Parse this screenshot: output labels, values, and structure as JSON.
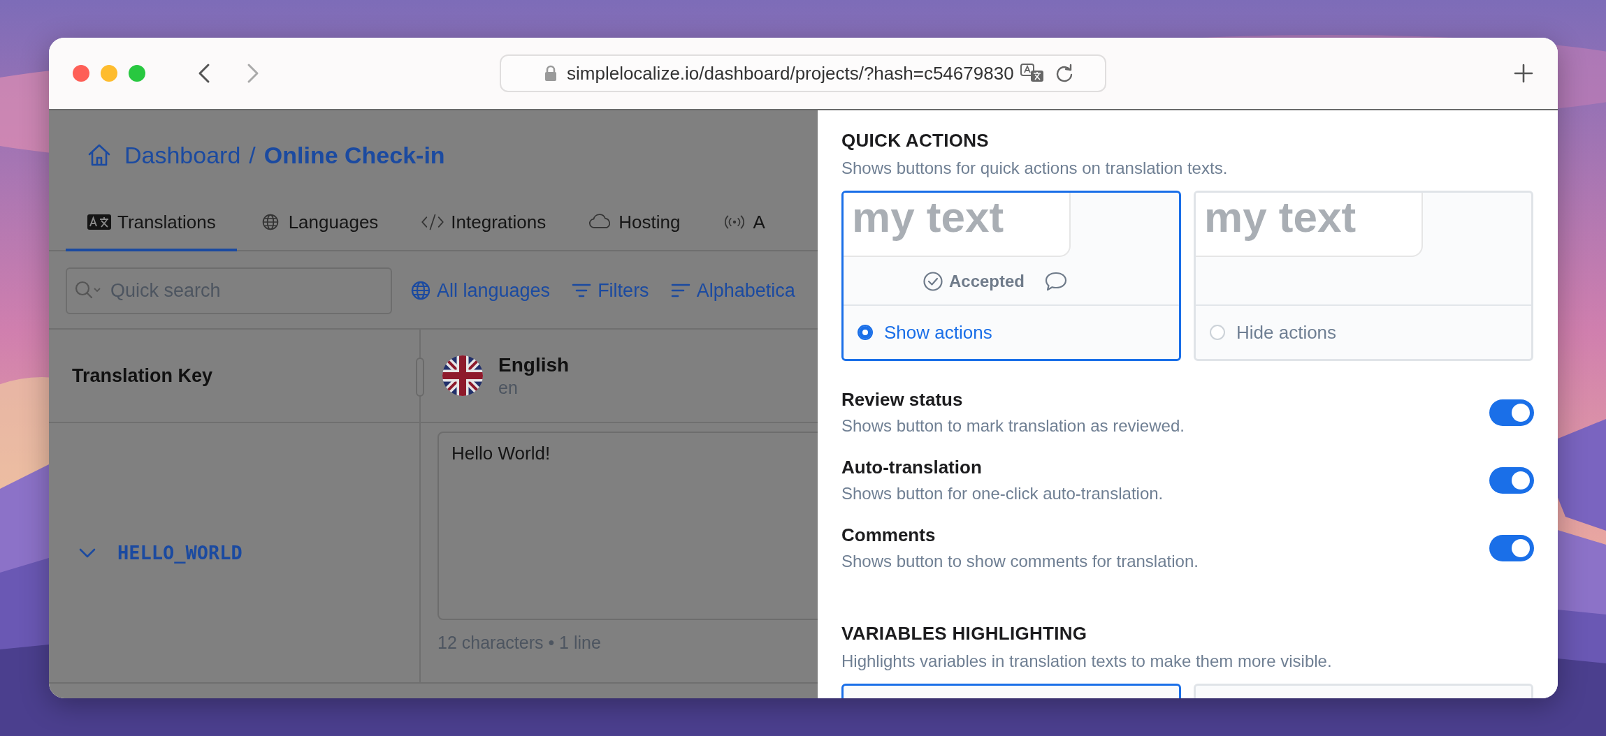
{
  "browser": {
    "url": "simplelocalize.io/dashboard/projects/?hash=c54679830"
  },
  "breadcrumb": {
    "parent": "Dashboard",
    "separator": "/",
    "current": "Online Check-in"
  },
  "tabs": [
    {
      "label": "Translations",
      "kind": "translate",
      "selected": true
    },
    {
      "label": "Languages",
      "kind": "globe",
      "selected": false
    },
    {
      "label": "Integrations",
      "kind": "code",
      "selected": false
    },
    {
      "label": "Hosting",
      "kind": "cloud",
      "selected": false
    },
    {
      "label": "A",
      "kind": "broadcast",
      "selected": false
    }
  ],
  "search": {
    "placeholder": "Quick search"
  },
  "toolbar": [
    {
      "label": "All languages",
      "kind": "globe"
    },
    {
      "label": "Filters",
      "kind": "filter"
    },
    {
      "label": "Alphabetica",
      "kind": "sort"
    }
  ],
  "table": {
    "columns": [
      {
        "label": "Translation Key"
      },
      {
        "label": "English",
        "code": "en"
      }
    ],
    "rows": [
      {
        "key": "HELLO_WORLD",
        "expanded": true,
        "text": "Hello World!",
        "stats": "12 characters • 1 line"
      }
    ]
  },
  "settings": {
    "sections": [
      {
        "title": "QUICK ACTIONS",
        "description": "Shows buttons for quick actions on translation texts.",
        "options": [
          {
            "label": "Show actions",
            "selected": true,
            "preview_text": "my text",
            "badge": "Accepted"
          },
          {
            "label": "Hide actions",
            "selected": false,
            "preview_text": "my text"
          }
        ],
        "toggles": [
          {
            "label": "Review status",
            "description": "Shows button to mark translation as reviewed.",
            "on": true
          },
          {
            "label": "Auto-translation",
            "description": "Shows button for one-click auto-translation.",
            "on": true
          },
          {
            "label": "Comments",
            "description": "Shows button to show comments for translation.",
            "on": true
          }
        ]
      },
      {
        "title": "VARIABLES HIGHLIGHTING",
        "description": "Highlights variables in translation texts to make them more visible.",
        "options": [
          {
            "selected": true
          },
          {
            "selected": false
          }
        ]
      }
    ]
  }
}
